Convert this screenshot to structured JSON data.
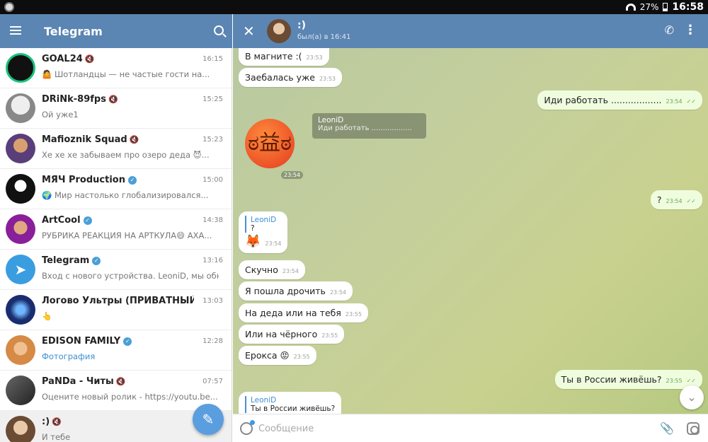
{
  "status": {
    "battery": "27%",
    "time": "16:58"
  },
  "sidebar": {
    "title": "Telegram",
    "chats": [
      {
        "name": "GOAL24",
        "time": "16:15",
        "preview": "🤷 Шотландцы — не частые гости на...",
        "avatar_color": "#111111",
        "verified": false
      },
      {
        "name": "DRiNk-89fps",
        "time": "15:25",
        "preview": "Ой уже1",
        "avatar_color": "#c9c9c9",
        "verified": false
      },
      {
        "name": "Mafioznik Squad",
        "time": "15:23",
        "preview": "Хе хе хе забываем про озеро деда 😈...",
        "avatar_color": "#5a3e7a",
        "verified": false
      },
      {
        "name": "МЯЧ Production",
        "time": "15:00",
        "preview": "🌍 Мир настолько глобализировался...",
        "avatar_color": "#111111",
        "verified": true
      },
      {
        "name": "ArtCool",
        "time": "14:38",
        "preview": "РУБРИКА РЕАКЦИЯ НА АРТКУЛА😄 АХА...",
        "avatar_color": "#8a1f9a",
        "verified": true
      },
      {
        "name": "Telegram",
        "time": "13:16",
        "preview": "Вход с нового устройства. LeoniD, мы обн...",
        "avatar_color": "#3a9de0",
        "verified": true
      },
      {
        "name": "Логово Ультры (ПРИВАТНЫЙ С...",
        "time": "13:03",
        "preview": "👆",
        "avatar_color": "#1a2d6e",
        "verified": false
      },
      {
        "name": "EDISON FAMILY",
        "time": "12:28",
        "preview": "Фотография",
        "avatar_color": "#d58a45",
        "verified": true
      },
      {
        "name": "PaNDa - Читы",
        "time": "07:57",
        "preview": "Оцените новый ролик - https://youtu.be...",
        "avatar_color": "#444444",
        "verified": false
      },
      {
        "name": ":)",
        "time": "",
        "preview": "И тебе",
        "avatar_color": "#8a5a3c",
        "verified": false
      }
    ]
  },
  "chat": {
    "title": ":)",
    "subtitle": "был(а) в 16:41",
    "messages": {
      "m1": {
        "text": "В магните :(",
        "time": "23:53"
      },
      "m2": {
        "text": "Заебалась уже",
        "time": "23:53"
      },
      "m3": {
        "text": "Иди работать ..................",
        "time": "23:54"
      },
      "sticker_reply": {
        "name": "LeoniD",
        "text": "Иди работать ..................",
        "time": "23:54"
      },
      "m4": {
        "text": "?",
        "time": "23:54"
      },
      "m5": {
        "reply_name": "LeoniD",
        "reply_text": "?",
        "text": "🦊",
        "time": "23:54"
      },
      "m6": {
        "text": "Скучно",
        "time": "23:54"
      },
      "m7": {
        "text": "Я пошла дрочить",
        "time": "23:54"
      },
      "m8": {
        "text": "На деда или на тебя",
        "time": "23:55"
      },
      "m9": {
        "text": "Или на чёрного",
        "time": "23:55"
      },
      "m10": {
        "text": "Ерокса 😡",
        "time": "23:55"
      },
      "m11": {
        "text": "Ты в России живёшь?",
        "time": "23:55"
      },
      "m12": {
        "reply_name": "LeoniD",
        "reply_text": "Ты в России живёшь?"
      }
    },
    "input_placeholder": "Сообщение"
  }
}
